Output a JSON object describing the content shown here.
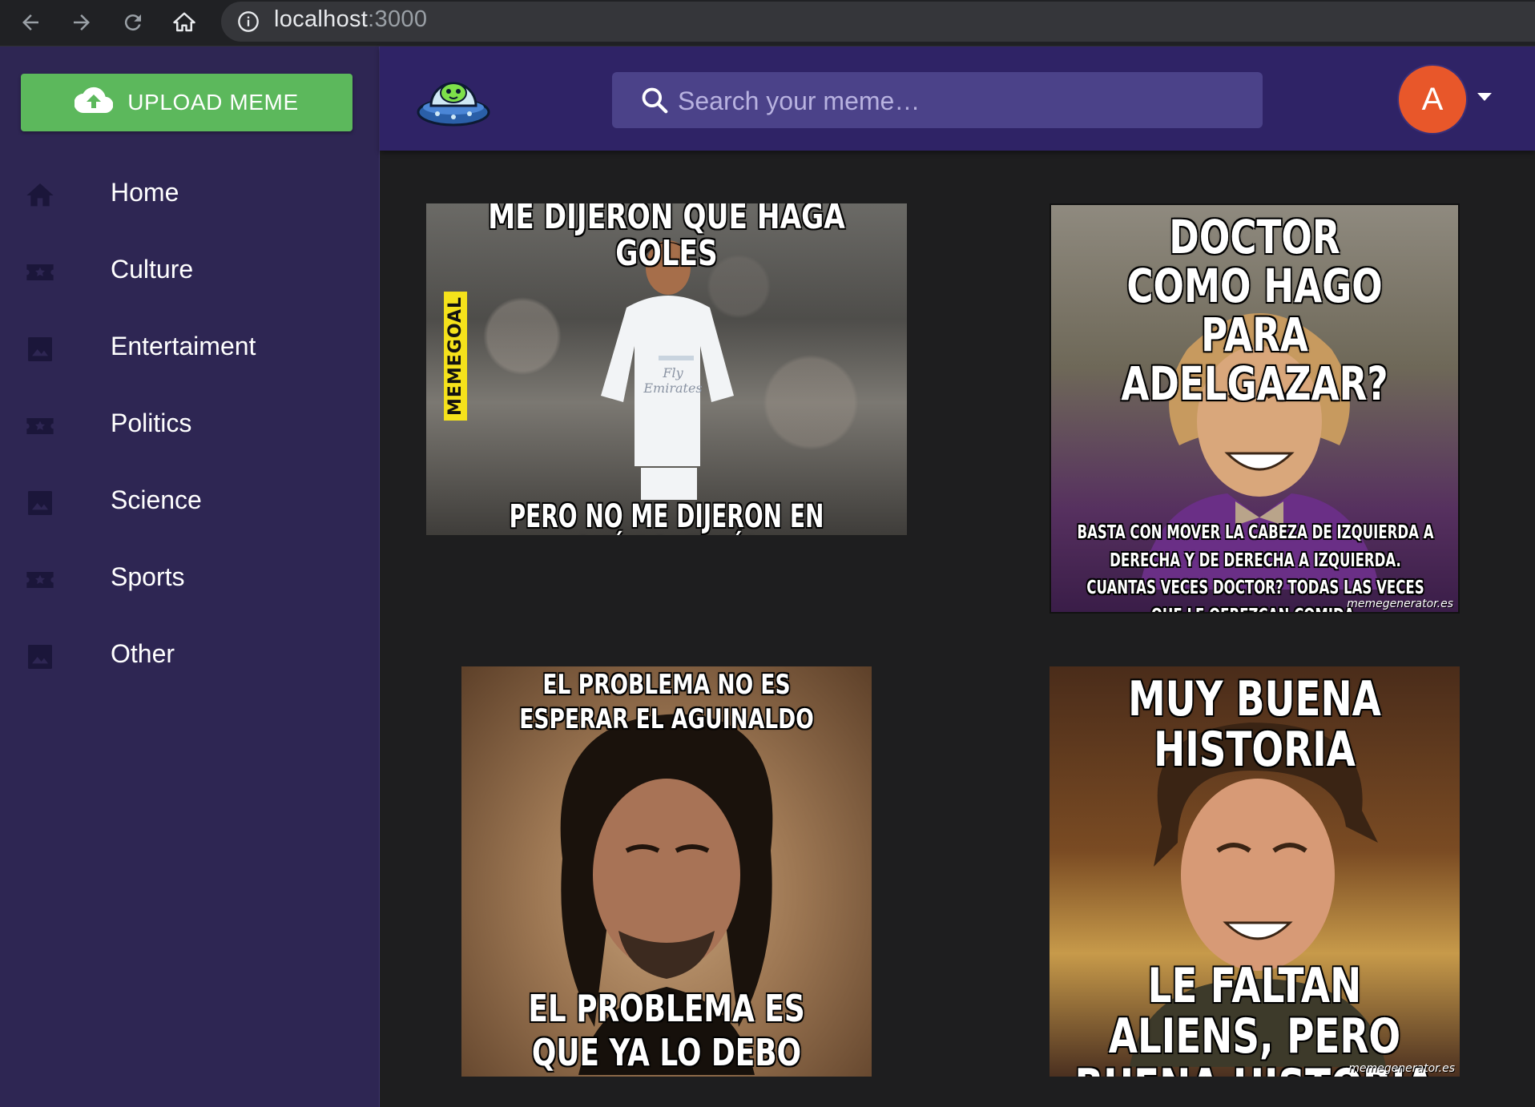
{
  "browser": {
    "url_host": "localhost",
    "url_port": ":3000"
  },
  "sidebar": {
    "upload_label": "UPLOAD MEME",
    "items": [
      {
        "label": "Home",
        "icon": "home-icon"
      },
      {
        "label": "Culture",
        "icon": "ticket-star-icon"
      },
      {
        "label": "Entertaiment",
        "icon": "image-icon"
      },
      {
        "label": "Politics",
        "icon": "ticket-star-icon"
      },
      {
        "label": "Science",
        "icon": "image-icon"
      },
      {
        "label": "Sports",
        "icon": "ticket-star-icon"
      },
      {
        "label": "Other",
        "icon": "image-icon"
      }
    ]
  },
  "header": {
    "search_placeholder": "Search your meme…",
    "avatar_letter": "A"
  },
  "memes": [
    {
      "top": "ME DIJERON QUE HAGA GOLES",
      "bottom": "PERO NO ME DIJERON EN QUÉ PORTERÍA",
      "side": "MEMEGOAL",
      "shirt": "Fly Emirates"
    },
    {
      "top": "DOCTOR COMO HAGO PARA ADELGAZAR?",
      "bottom": "BASTA CON MOVER LA CABEZA DE IZQUIERDA A DERECHA Y DE DERECHA A IZQUIERDA. CUANTAS VECES DOCTOR? TODAS LAS VECES QUE LE OFREZCAN COMIDA.",
      "watermark": "memegenerator.es"
    },
    {
      "top": "EL PROBLEMA NO ES ESPERAR EL AGUINALDO",
      "bottom": "EL PROBLEMA ES QUE YA LO DEBO TODO"
    },
    {
      "top": "MUY BUENA HISTORIA",
      "bottom": "LE FALTAN ALIENS, PERO BUENA HISTORIA",
      "watermark": "memegenerator.es"
    }
  ],
  "colors": {
    "sidebar_bg": "#2e2653",
    "appbar_bg": "#2f2366",
    "upload_green": "#5cb85c",
    "avatar_orange": "#e8572a",
    "content_bg": "#1e1e1f"
  }
}
